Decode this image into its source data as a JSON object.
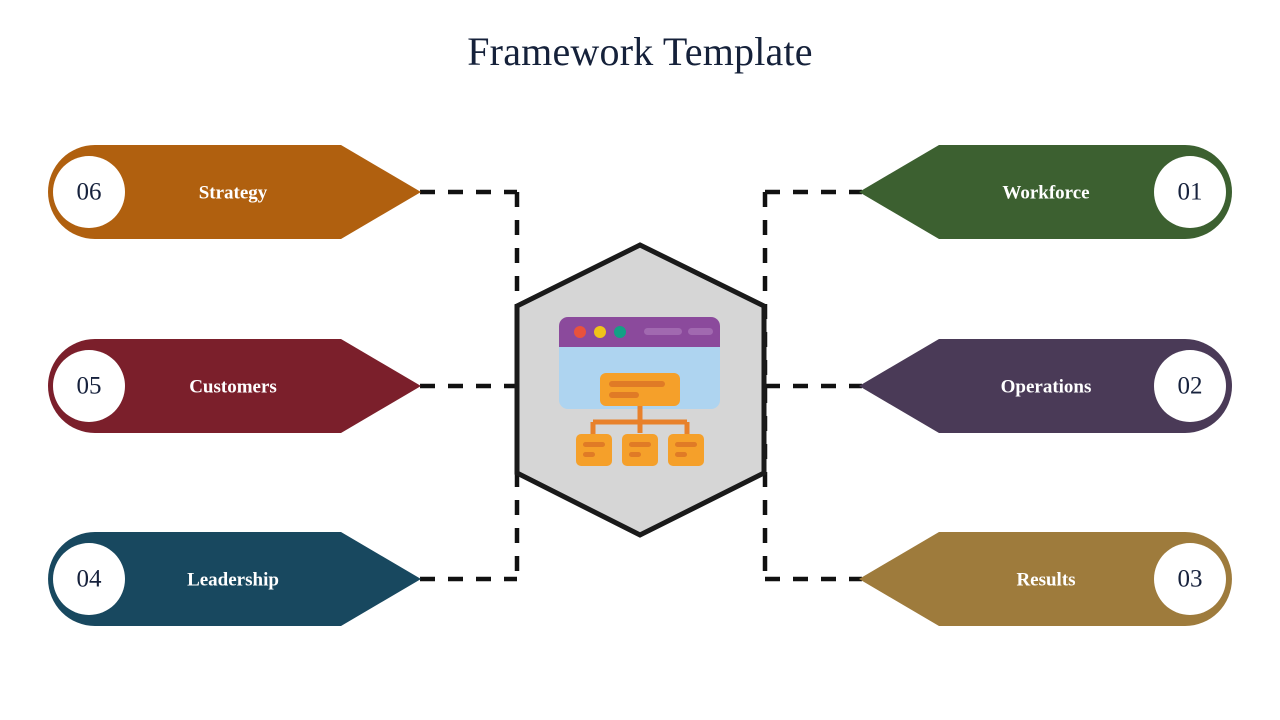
{
  "title": "Framework Template",
  "background_color": "#ffffff",
  "title_color": "#15213a",
  "connector": {
    "color": "#111111",
    "style": "dashed"
  },
  "center": {
    "shape": "hexagon",
    "fill": "#d6d6d6",
    "stroke": "#1a1a1a",
    "icon_name": "browser-org-chart-icon",
    "browser": {
      "titlebar_color": "#8b4a9c",
      "body_color": "#aed4f0",
      "dots": [
        {
          "name": "red-dot",
          "color": "#e8523c"
        },
        {
          "name": "yellow-dot",
          "color": "#f0c419"
        },
        {
          "name": "green-dot",
          "color": "#13a085"
        }
      ],
      "pill_color": "#a169b0",
      "node_fill": "#f5a02a",
      "node_line": "#e07b26",
      "connector_color": "#e8812b",
      "child_node_count": 3
    }
  },
  "left_items": [
    {
      "number": "06",
      "label": "Strategy",
      "color": "#b0600f",
      "side": "left",
      "row": 1
    },
    {
      "number": "05",
      "label": "Customers",
      "color": "#7b1f2b",
      "side": "left",
      "row": 2
    },
    {
      "number": "04",
      "label": "Leadership",
      "color": "#18485f",
      "side": "left",
      "row": 3
    }
  ],
  "right_items": [
    {
      "number": "01",
      "label": "Workforce",
      "color": "#3c6030",
      "side": "right",
      "row": 1
    },
    {
      "number": "02",
      "label": "Operations",
      "color": "#4a3a57",
      "side": "right",
      "row": 2
    },
    {
      "number": "03",
      "label": "Results",
      "color": "#9e7b3c",
      "side": "right",
      "row": 3
    }
  ]
}
